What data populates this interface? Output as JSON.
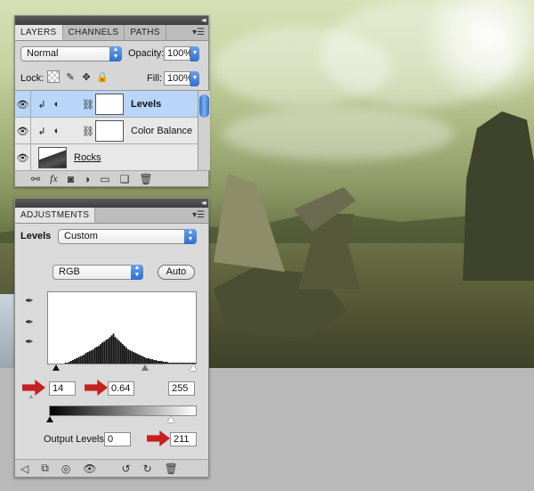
{
  "layers_panel": {
    "tabs": [
      "LAYERS",
      "CHANNELS",
      "PATHS"
    ],
    "blend_mode": "Normal",
    "opacity_label": "Opacity:",
    "opacity_value": "100%",
    "lock_label": "Lock:",
    "fill_label": "Fill:",
    "fill_value": "100%",
    "layers": [
      {
        "name": "Levels",
        "selected": true
      },
      {
        "name": "Color Balance",
        "selected": false
      },
      {
        "name": "Rocks",
        "selected": false
      }
    ],
    "bottom_icons": [
      "link-icon",
      "fx-icon",
      "mask-icon",
      "adjustment-icon",
      "folder-icon",
      "new-layer-icon",
      "trash-icon"
    ]
  },
  "adjustments_panel": {
    "tab": "ADJUSTMENTS",
    "type_label": "Levels",
    "preset": "Custom",
    "channel": "RGB",
    "auto_label": "Auto",
    "input_black": "14",
    "input_gamma": "0.64",
    "input_white": "255",
    "output_label": "Output Levels:",
    "output_black": "0",
    "output_white": "211",
    "bottom_icons": [
      "back-icon",
      "expand-icon",
      "clip-icon",
      "visibility-icon",
      "previous-state-icon",
      "reset-icon",
      "trash-icon"
    ]
  },
  "histogram": {
    "bins": [
      0,
      0,
      0,
      0,
      0,
      0,
      0,
      0,
      0,
      1,
      1,
      2,
      3,
      4,
      5,
      6,
      7,
      8,
      9,
      10,
      12,
      13,
      14,
      15,
      16,
      18,
      19,
      20,
      22,
      24,
      25,
      27,
      28,
      30,
      32,
      34,
      30,
      28,
      26,
      24,
      22,
      20,
      18,
      16,
      15,
      14,
      13,
      12,
      11,
      10,
      9,
      8,
      7,
      6,
      6,
      5,
      5,
      4,
      4,
      3,
      3,
      3,
      2,
      2,
      2,
      1,
      1,
      1,
      1,
      1,
      1,
      1,
      1,
      1,
      1,
      1,
      1,
      1,
      1,
      1
    ]
  },
  "colors": {
    "accent_blue": "#2d6fd0",
    "selected_row": "#b9d5f7",
    "arrow_red": "#c62020"
  }
}
